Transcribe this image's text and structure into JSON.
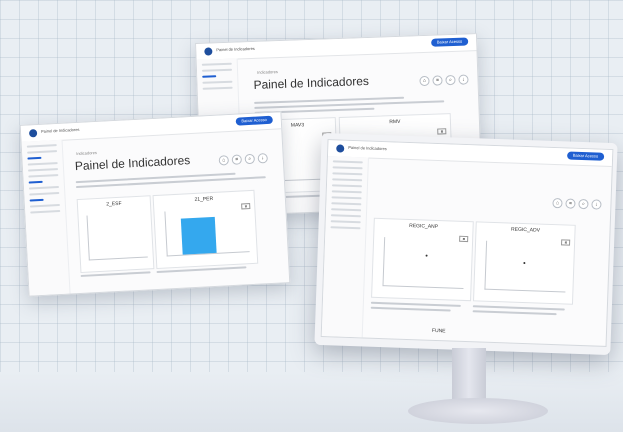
{
  "brand": "Painel de Indicadores",
  "cta_label": "Baixar Acesso",
  "page_title": "Painel de Indicadores",
  "breadcrumb": "Indicadores",
  "icons": [
    "home-icon",
    "search-icon",
    "download-icon"
  ],
  "window_back": {
    "panels": [
      {
        "title": "MAV3"
      },
      {
        "title": "RMV"
      }
    ]
  },
  "window_left": {
    "panels": [
      {
        "title": "2_ESF"
      },
      {
        "title": "21_PER"
      }
    ]
  },
  "window_monitor": {
    "panels": [
      {
        "title": "REGIC_ANP"
      },
      {
        "title": "REGIC_ADV"
      },
      {
        "title": "FUNE"
      }
    ]
  },
  "chart_data": [
    {
      "type": "bar",
      "title": "21_PER",
      "values": [
        1
      ]
    }
  ]
}
